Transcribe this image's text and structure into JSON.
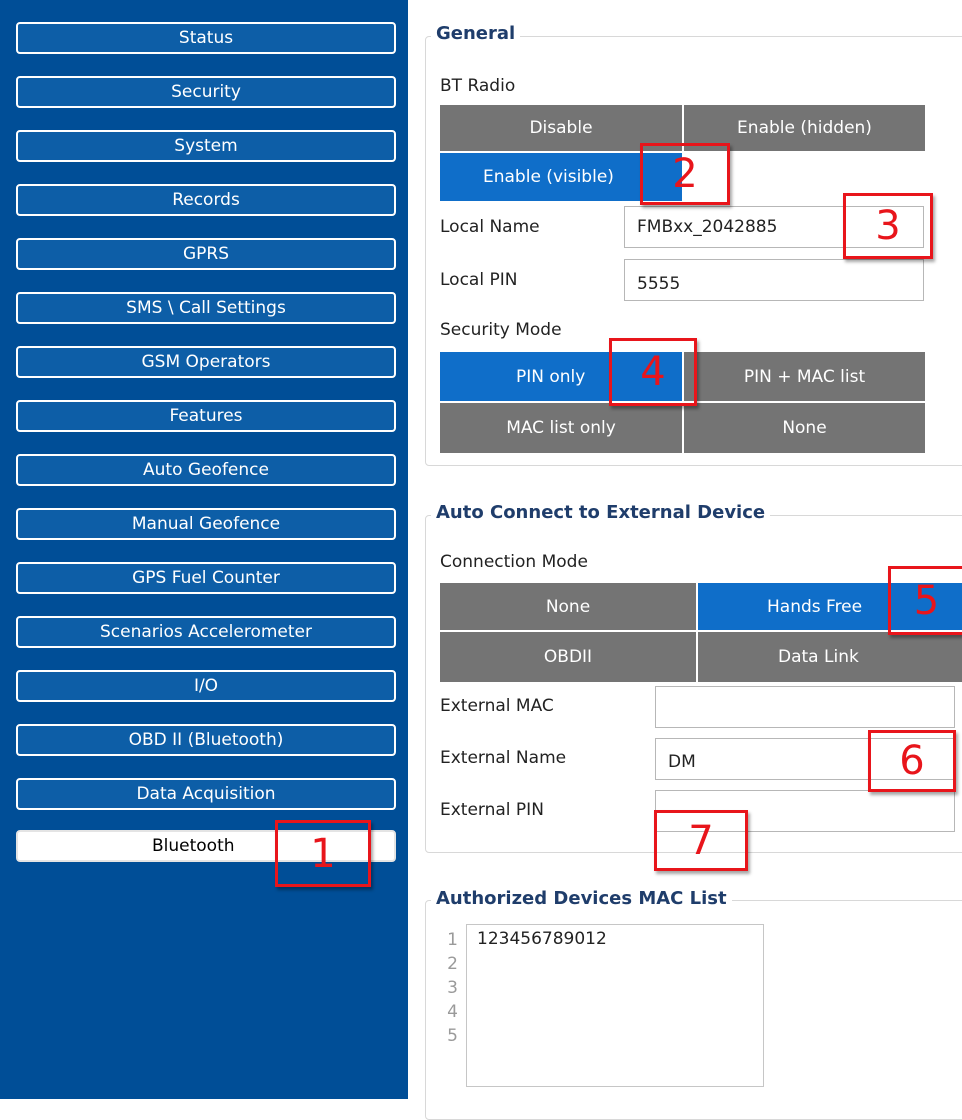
{
  "sidebar": {
    "items": [
      {
        "label": "Status"
      },
      {
        "label": "Security"
      },
      {
        "label": "System"
      },
      {
        "label": "Records"
      },
      {
        "label": "GPRS"
      },
      {
        "label": "SMS \\ Call Settings"
      },
      {
        "label": "GSM Operators"
      },
      {
        "label": "Features"
      },
      {
        "label": "Auto Geofence"
      },
      {
        "label": "Manual Geofence"
      },
      {
        "label": "GPS Fuel Counter"
      },
      {
        "label": "Scenarios Accelerometer"
      },
      {
        "label": "I/O"
      },
      {
        "label": "OBD II (Bluetooth)"
      },
      {
        "label": "Data Acquisition"
      },
      {
        "label": "Bluetooth"
      }
    ],
    "selected": "Bluetooth"
  },
  "general": {
    "title": "General",
    "bt_radio_label": "BT Radio",
    "bt_radio_options": [
      "Disable",
      "Enable (hidden)",
      "Enable (visible)"
    ],
    "bt_radio_selected": "Enable (visible)",
    "local_name_label": "Local Name",
    "local_name_value": "FMBxx_2042885",
    "local_pin_label": "Local PIN",
    "local_pin_value": "5555",
    "security_mode_label": "Security Mode",
    "security_mode_options": [
      "PIN only",
      "PIN + MAC list",
      "MAC list only",
      "None"
    ],
    "security_mode_selected": "PIN only"
  },
  "auto_connect": {
    "title": "Auto Connect to External Device",
    "connection_mode_label": "Connection Mode",
    "connection_mode_options": [
      "None",
      "Hands Free",
      "OBDII",
      "Data Link"
    ],
    "connection_mode_selected": "Hands Free",
    "external_mac_label": "External MAC",
    "external_mac_value": "",
    "external_name_label": "External Name",
    "external_name_value": "DM",
    "external_pin_label": "External PIN",
    "external_pin_value": ""
  },
  "mac_list": {
    "title": "Authorized Devices MAC List",
    "line_numbers": [
      "1",
      "2",
      "3",
      "4",
      "5"
    ],
    "entries": [
      "123456789012"
    ]
  },
  "annotations": [
    "1",
    "2",
    "3",
    "4",
    "5",
    "6",
    "7"
  ],
  "colors": {
    "sidebar_bg": "#004e97",
    "nav_button": "#0d5ea7",
    "segment_off": "#747474",
    "segment_on": "#0f6ec9",
    "legend_text": "#1f3d6b",
    "annotation_red": "#e8151b"
  }
}
